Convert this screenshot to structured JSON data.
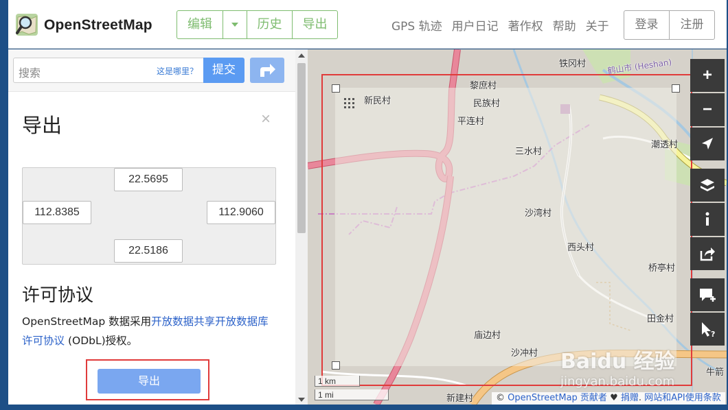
{
  "header": {
    "brand": "OpenStreetMap",
    "edit_label": "编辑",
    "history_label": "历史",
    "export_label": "导出",
    "nav": [
      "GPS 轨迹",
      "用户日记",
      "著作权",
      "帮助",
      "关于"
    ],
    "login_label": "登录",
    "signup_label": "注册"
  },
  "search": {
    "placeholder": "搜索",
    "where_label": "这是哪里？",
    "submit_label": "提交"
  },
  "export_panel": {
    "title": "导出",
    "close_glyph": "×",
    "bbox": {
      "top": "22.5695",
      "left": "112.8385",
      "right": "112.9060",
      "bottom": "22.5186"
    },
    "license_title": "许可协议",
    "license_text_before": "OpenStreetMap 数据采用",
    "license_link": "开放数据共享开放数据库许可协议",
    "license_text_after": " (ODbL)授权。",
    "export_button": "导出"
  },
  "map": {
    "labels": {
      "tiegang": "铁冈村",
      "heshan": "鹤山市 (Heshan)",
      "lishu": "黎庶村",
      "xinmin": "新民村",
      "minzu": "民族村",
      "pinglian": "平连村",
      "sanshui": "三水村",
      "chaotou": "潮透村",
      "shawan": "沙湾村",
      "xitou": "西头村",
      "qiaoting": "桥亭村",
      "tianjin": "田金村",
      "miaobian": "庙边村",
      "shachong": "沙冲村",
      "xinjian": "新建村",
      "niu": "牛箭"
    },
    "scale_km": "1 km",
    "scale_mi": "1 mi",
    "controls": [
      "zoom-in",
      "zoom-out",
      "locate",
      "layers",
      "info",
      "share",
      "note",
      "query"
    ],
    "attribution": {
      "copy": "© ",
      "osm_contrib": "OpenStreetMap 贡献者",
      "heart": " ♥ ",
      "donate": "捐赠",
      "terms": "网站和API使用条款"
    },
    "watermark_text": "Baidu 经验",
    "watermark_url": "jingyan.baidu.com"
  },
  "colors": {
    "brand_green": "#7ebc6f",
    "submit_blue": "#5b9bf2",
    "highlight_red": "#e03a3a",
    "motorway": "#e8879a",
    "trunk_yellow": "#f7f49a",
    "primary_orange": "#f5c686",
    "water": "#a6c8e0",
    "boundary": "#c77fc4"
  }
}
